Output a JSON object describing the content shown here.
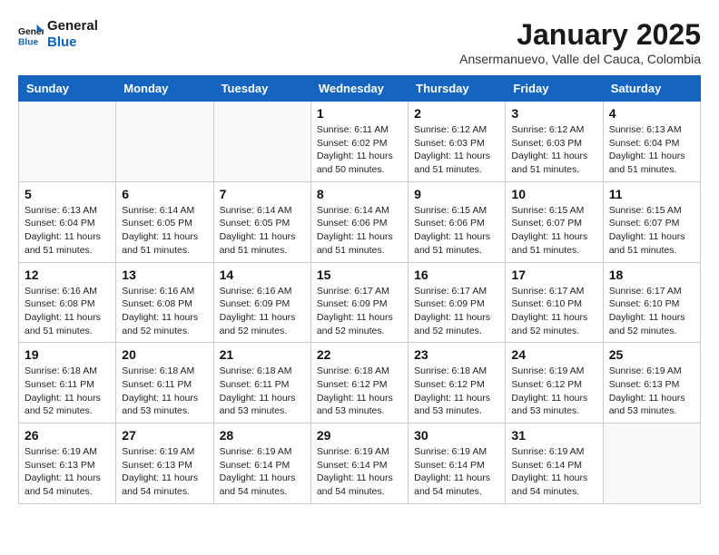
{
  "header": {
    "logo_general": "General",
    "logo_blue": "Blue",
    "month_title": "January 2025",
    "subtitle": "Ansermanuevo, Valle del Cauca, Colombia"
  },
  "weekdays": [
    "Sunday",
    "Monday",
    "Tuesday",
    "Wednesday",
    "Thursday",
    "Friday",
    "Saturday"
  ],
  "weeks": [
    [
      {
        "day": "",
        "sunrise": "",
        "sunset": "",
        "daylight": ""
      },
      {
        "day": "",
        "sunrise": "",
        "sunset": "",
        "daylight": ""
      },
      {
        "day": "",
        "sunrise": "",
        "sunset": "",
        "daylight": ""
      },
      {
        "day": "1",
        "sunrise": "Sunrise: 6:11 AM",
        "sunset": "Sunset: 6:02 PM",
        "daylight": "Daylight: 11 hours and 50 minutes."
      },
      {
        "day": "2",
        "sunrise": "Sunrise: 6:12 AM",
        "sunset": "Sunset: 6:03 PM",
        "daylight": "Daylight: 11 hours and 51 minutes."
      },
      {
        "day": "3",
        "sunrise": "Sunrise: 6:12 AM",
        "sunset": "Sunset: 6:03 PM",
        "daylight": "Daylight: 11 hours and 51 minutes."
      },
      {
        "day": "4",
        "sunrise": "Sunrise: 6:13 AM",
        "sunset": "Sunset: 6:04 PM",
        "daylight": "Daylight: 11 hours and 51 minutes."
      }
    ],
    [
      {
        "day": "5",
        "sunrise": "Sunrise: 6:13 AM",
        "sunset": "Sunset: 6:04 PM",
        "daylight": "Daylight: 11 hours and 51 minutes."
      },
      {
        "day": "6",
        "sunrise": "Sunrise: 6:14 AM",
        "sunset": "Sunset: 6:05 PM",
        "daylight": "Daylight: 11 hours and 51 minutes."
      },
      {
        "day": "7",
        "sunrise": "Sunrise: 6:14 AM",
        "sunset": "Sunset: 6:05 PM",
        "daylight": "Daylight: 11 hours and 51 minutes."
      },
      {
        "day": "8",
        "sunrise": "Sunrise: 6:14 AM",
        "sunset": "Sunset: 6:06 PM",
        "daylight": "Daylight: 11 hours and 51 minutes."
      },
      {
        "day": "9",
        "sunrise": "Sunrise: 6:15 AM",
        "sunset": "Sunset: 6:06 PM",
        "daylight": "Daylight: 11 hours and 51 minutes."
      },
      {
        "day": "10",
        "sunrise": "Sunrise: 6:15 AM",
        "sunset": "Sunset: 6:07 PM",
        "daylight": "Daylight: 11 hours and 51 minutes."
      },
      {
        "day": "11",
        "sunrise": "Sunrise: 6:15 AM",
        "sunset": "Sunset: 6:07 PM",
        "daylight": "Daylight: 11 hours and 51 minutes."
      }
    ],
    [
      {
        "day": "12",
        "sunrise": "Sunrise: 6:16 AM",
        "sunset": "Sunset: 6:08 PM",
        "daylight": "Daylight: 11 hours and 51 minutes."
      },
      {
        "day": "13",
        "sunrise": "Sunrise: 6:16 AM",
        "sunset": "Sunset: 6:08 PM",
        "daylight": "Daylight: 11 hours and 52 minutes."
      },
      {
        "day": "14",
        "sunrise": "Sunrise: 6:16 AM",
        "sunset": "Sunset: 6:09 PM",
        "daylight": "Daylight: 11 hours and 52 minutes."
      },
      {
        "day": "15",
        "sunrise": "Sunrise: 6:17 AM",
        "sunset": "Sunset: 6:09 PM",
        "daylight": "Daylight: 11 hours and 52 minutes."
      },
      {
        "day": "16",
        "sunrise": "Sunrise: 6:17 AM",
        "sunset": "Sunset: 6:09 PM",
        "daylight": "Daylight: 11 hours and 52 minutes."
      },
      {
        "day": "17",
        "sunrise": "Sunrise: 6:17 AM",
        "sunset": "Sunset: 6:10 PM",
        "daylight": "Daylight: 11 hours and 52 minutes."
      },
      {
        "day": "18",
        "sunrise": "Sunrise: 6:17 AM",
        "sunset": "Sunset: 6:10 PM",
        "daylight": "Daylight: 11 hours and 52 minutes."
      }
    ],
    [
      {
        "day": "19",
        "sunrise": "Sunrise: 6:18 AM",
        "sunset": "Sunset: 6:11 PM",
        "daylight": "Daylight: 11 hours and 52 minutes."
      },
      {
        "day": "20",
        "sunrise": "Sunrise: 6:18 AM",
        "sunset": "Sunset: 6:11 PM",
        "daylight": "Daylight: 11 hours and 53 minutes."
      },
      {
        "day": "21",
        "sunrise": "Sunrise: 6:18 AM",
        "sunset": "Sunset: 6:11 PM",
        "daylight": "Daylight: 11 hours and 53 minutes."
      },
      {
        "day": "22",
        "sunrise": "Sunrise: 6:18 AM",
        "sunset": "Sunset: 6:12 PM",
        "daylight": "Daylight: 11 hours and 53 minutes."
      },
      {
        "day": "23",
        "sunrise": "Sunrise: 6:18 AM",
        "sunset": "Sunset: 6:12 PM",
        "daylight": "Daylight: 11 hours and 53 minutes."
      },
      {
        "day": "24",
        "sunrise": "Sunrise: 6:19 AM",
        "sunset": "Sunset: 6:12 PM",
        "daylight": "Daylight: 11 hours and 53 minutes."
      },
      {
        "day": "25",
        "sunrise": "Sunrise: 6:19 AM",
        "sunset": "Sunset: 6:13 PM",
        "daylight": "Daylight: 11 hours and 53 minutes."
      }
    ],
    [
      {
        "day": "26",
        "sunrise": "Sunrise: 6:19 AM",
        "sunset": "Sunset: 6:13 PM",
        "daylight": "Daylight: 11 hours and 54 minutes."
      },
      {
        "day": "27",
        "sunrise": "Sunrise: 6:19 AM",
        "sunset": "Sunset: 6:13 PM",
        "daylight": "Daylight: 11 hours and 54 minutes."
      },
      {
        "day": "28",
        "sunrise": "Sunrise: 6:19 AM",
        "sunset": "Sunset: 6:14 PM",
        "daylight": "Daylight: 11 hours and 54 minutes."
      },
      {
        "day": "29",
        "sunrise": "Sunrise: 6:19 AM",
        "sunset": "Sunset: 6:14 PM",
        "daylight": "Daylight: 11 hours and 54 minutes."
      },
      {
        "day": "30",
        "sunrise": "Sunrise: 6:19 AM",
        "sunset": "Sunset: 6:14 PM",
        "daylight": "Daylight: 11 hours and 54 minutes."
      },
      {
        "day": "31",
        "sunrise": "Sunrise: 6:19 AM",
        "sunset": "Sunset: 6:14 PM",
        "daylight": "Daylight: 11 hours and 54 minutes."
      },
      {
        "day": "",
        "sunrise": "",
        "sunset": "",
        "daylight": ""
      }
    ]
  ]
}
